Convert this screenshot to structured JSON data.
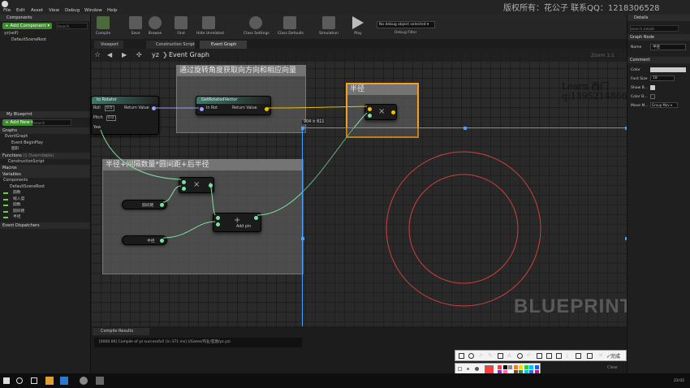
{
  "menu": [
    "File",
    "Edit",
    "Asset",
    "View",
    "Debug",
    "Window",
    "Help"
  ],
  "watermark": "版权所有：花公子 联系QQ：1218306528",
  "components": {
    "tab": "Components",
    "add": "+ Add Component ▾",
    "search_placeholder": "Search",
    "root": "yz(self)",
    "scene_root": "DefaultSceneRoot"
  },
  "toolbar": [
    {
      "label": "Compile"
    },
    {
      "label": "Save"
    },
    {
      "label": "Browse"
    },
    {
      "label": "Find"
    },
    {
      "label": "Hide Unrelated"
    },
    {
      "label": "Class Settings"
    },
    {
      "label": "Class Defaults"
    },
    {
      "label": "Simulation"
    },
    {
      "label": "Play"
    }
  ],
  "debug_filter": {
    "value": "No debug object selected ▾",
    "label": "Debug Filter"
  },
  "tabs": {
    "viewport": "Viewport",
    "construction": "Construction Script",
    "event_graph": "Event Graph"
  },
  "breadcrumb": {
    "root": "yz",
    "current": "Event Graph"
  },
  "zoom": "Zoom 1:1",
  "my_blueprint": {
    "tab": "My Blueprint",
    "add_new": "+ Add New ▾",
    "search_placeholder": "Search",
    "graphs": "Graphs",
    "event_graph": "EventGraph",
    "begin_play": "Event BeginPlay",
    "tick": "图形",
    "functions": "Functions",
    "functions_count": "(1 Overridable)",
    "construction_script": "ConstructionScript",
    "macros": "Macros",
    "variables": "Variables",
    "components": "Components",
    "default_scene_root": "DefaultSceneRoot",
    "vars": [
      "圆数",
      "缩入度",
      "圆数",
      "圆间距",
      "半径"
    ],
    "event_dispatchers": "Event Dispatchers"
  },
  "nodes": {
    "rotator_partial": "to Rotator",
    "roll": "Roll",
    "pitch": "Pitch",
    "yaw": "Yaw",
    "val_0": "0.0",
    "return_value": "Return Value",
    "get_rotated_vector": "GetRotatedVector",
    "in_rot": "In Rot",
    "add_pin": "Add pin",
    "var_a": "圆间距",
    "var_b": "半径",
    "multiply": "×"
  },
  "comments": {
    "c1": "通过旋转角度获取向方向和相应向量",
    "c2": "半径+间隔数量*圆间距+后半径",
    "c3": "半径"
  },
  "handwritten": {
    "line1": "Learn 西门",
    "line2": "q:1395214866"
  },
  "selection": {
    "size": "904 × 611"
  },
  "watermark_logo": "BLUEPRINT",
  "compile": {
    "tab": "Compile Results",
    "log": "[0000.00] Compile of yz successful! [in 371 ms] (/Game/作业/亚图/yz.yz)",
    "clear": "Clear"
  },
  "annotation_toolbar": {
    "done": "完成"
  },
  "palette": {
    "colors": [
      "#ff3b3b",
      "#000000",
      "#8b8b8b",
      "#ff7f00",
      "#ffd500",
      "#32cd32",
      "#00bfff",
      "#1e5bff",
      "#8a2be2",
      "#ff69b4",
      "#ffffff",
      "#7a4b2a",
      "#2e8b57",
      "#00ced1",
      "#4169e1",
      "#c71585"
    ]
  },
  "details": {
    "tab": "Details",
    "search_placeholder": "Search Details",
    "graph_node": "Graph Node",
    "name_label": "Name",
    "name_value": "半径",
    "comment": "Comment",
    "color_label": "Color",
    "font_size_label": "Font Size",
    "font_size_value": "18",
    "show_bubble": "Show B...",
    "color_bubble": "Color B...",
    "move_mode_label": "Move M...",
    "move_mode_value": "Group Mov ▾"
  },
  "taskbar": {
    "time": "23:02"
  }
}
